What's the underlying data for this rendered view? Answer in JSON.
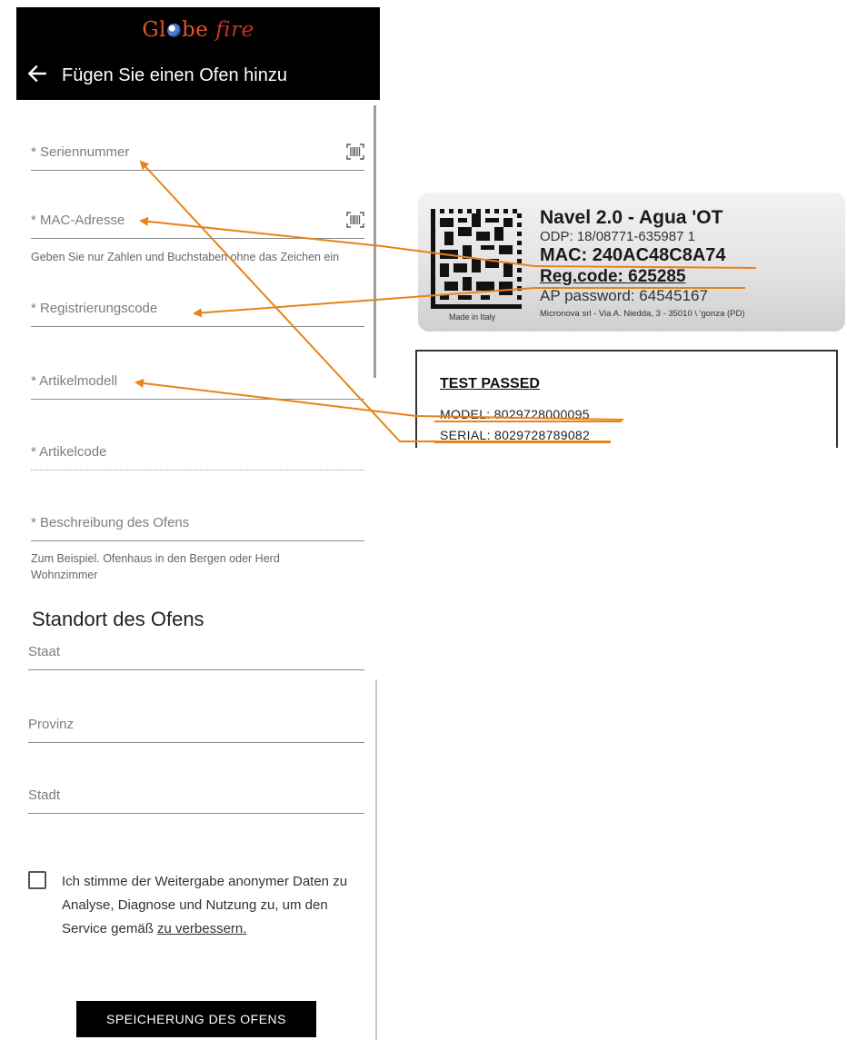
{
  "header": {
    "logo_text_a": "Gl",
    "logo_text_b": "be",
    "logo_text_fire": "fire",
    "title": "Fügen Sie einen Ofen hinzu"
  },
  "form": {
    "serial_placeholder": "* Seriennummer",
    "mac_placeholder": "* MAC-Adresse",
    "mac_hint": "Geben Sie nur Zahlen und Buchstaben ohne das Zeichen ein",
    "regcode_placeholder": "* Registrierungscode",
    "model_placeholder": "* Artikelmodell",
    "code_placeholder": "* Artikelcode",
    "description_placeholder": "* Beschreibung des Ofens",
    "description_hint": "Zum Beispiel. Ofenhaus in den Bergen oder Herd Wohnzimmer"
  },
  "location": {
    "title": "Standort des Ofens",
    "state_placeholder": "Staat",
    "province_placeholder": "Provinz",
    "city_placeholder": "Stadt"
  },
  "consent": {
    "text": "Ich stimme der Weitergabe anonymer Daten zu Analyse, Diagnose und Nutzung zu, um den Service gemäß ",
    "link": "zu verbessern.",
    "checked": false
  },
  "save_button": "SPEICHERUNG DES OFENS",
  "label_photo": {
    "product": "Navel 2.0 - Agua 'OT",
    "odp": "ODP: 18/08771-635987 1",
    "mac": "MAC: 240AC48C8A74",
    "reg_code": "Reg.code: 625285",
    "ap_password": "AP password: 64545167",
    "made_in": "Made in Italy",
    "footer": "Micronova srl - Via A. Niedda, 3 - 35010 \\ 'gonza (PD)"
  },
  "test_photo": {
    "title": "TEST PASSED",
    "model": "MODEL: 8029728000095",
    "serial": "SERIAL: 8029728789082"
  },
  "colors": {
    "header_bg": "#000000",
    "logo": "#e0532a",
    "arrow": "#e8821a",
    "button_bg": "#000000"
  }
}
